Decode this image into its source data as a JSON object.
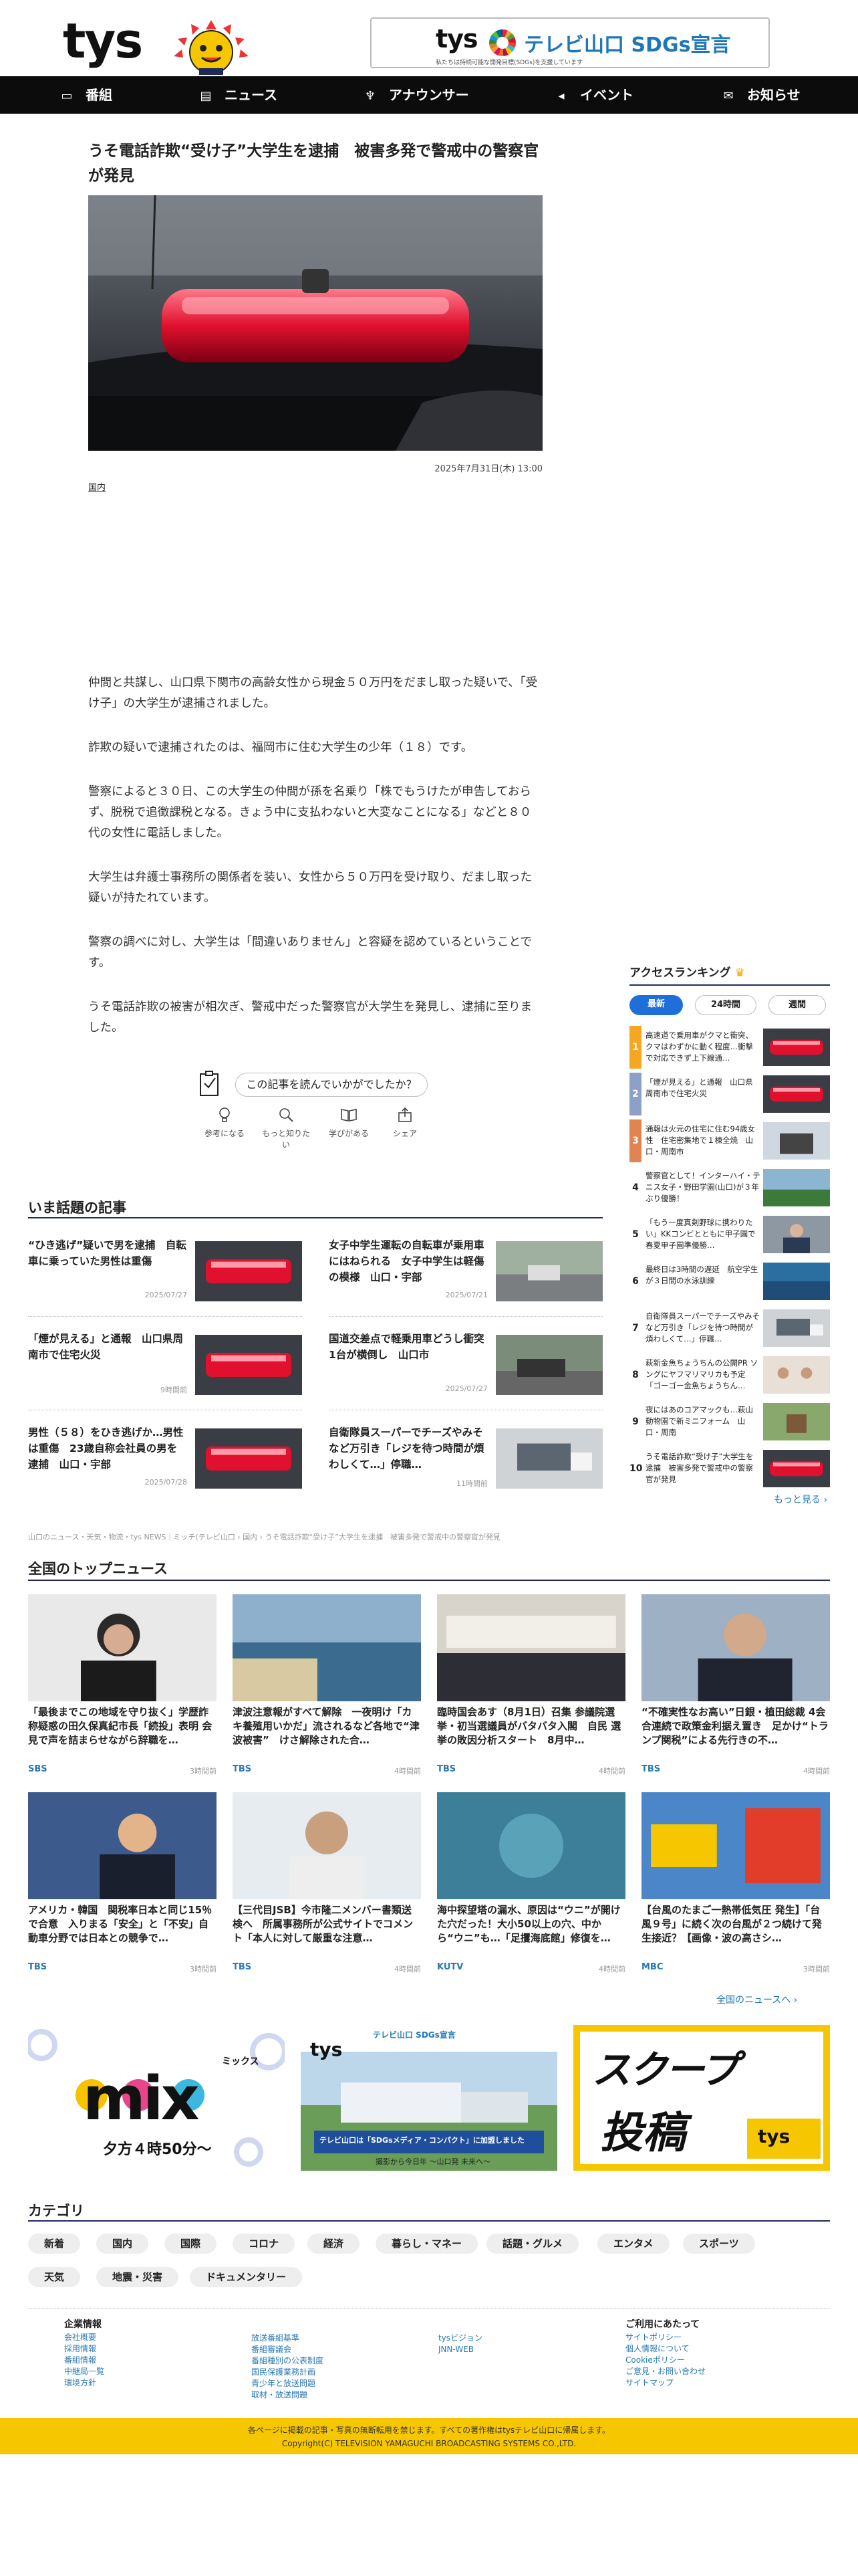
{
  "header": {
    "logo_text": "tys",
    "sdgs": {
      "brand": "tys",
      "title": "テレビ山口 SDGs宣言",
      "sub": "私たちは持続可能な開発目標(SDGs)を支援しています"
    }
  },
  "nav": [
    {
      "icon": "tv-icon",
      "label": "番組"
    },
    {
      "icon": "news-icon",
      "label": "ニュース"
    },
    {
      "icon": "microphone-icon",
      "label": "アナウンサー"
    },
    {
      "icon": "megaphone-icon",
      "label": "イベント"
    },
    {
      "icon": "mail-icon",
      "label": "お知らせ"
    }
  ],
  "article": {
    "title": "うそ電話詐欺“受け子”大学生を逮捕　被害多発で警戒中の警察官が発見",
    "date": "2025年7月31日(木) 13:00",
    "category": "国内",
    "paragraphs": [
      "仲間と共謀し、山口県下関市の高齢女性から現金５０万円をだまし取った疑いで、「受け子」の大学生が逮捕されました。",
      "詐欺の疑いで逮捕されたのは、福岡市に住む大学生の少年（１８）です。",
      "警察によると３０日、この大学生の仲間が孫を名乗り「株でもうけたが申告しておらず、脱税で追徴課税となる。きょう中に支払わないと大変なことになる」などと８０代の女性に電話しました。",
      "大学生は弁護士事務所の関係者を装い、女性から５０万円を受け取り、だまし取った疑いが持たれています。",
      "警察の調べに対し、大学生は「間違いありません」と容疑を認めているということです。",
      "うそ電話詐欺の被害が相次ぎ、警戒中だった警察官が大学生を発見し、逮捕に至りました。"
    ],
    "feedback_label": "この記事を読んでいかがでしたか？",
    "reactions": [
      {
        "icon": "lightbulb-icon",
        "label": "参考になる"
      },
      {
        "icon": "magnifier-icon",
        "label": "もっと知りたい"
      },
      {
        "icon": "book-icon",
        "label": "学びがある"
      },
      {
        "icon": "share-icon",
        "label": "シェア"
      }
    ]
  },
  "popular": {
    "heading": "いま話題の記事",
    "items": [
      {
        "title": "“ひき逃げ”疑いで男を逮捕　自転車に乗っていた男性は重傷",
        "date": "2025/07/27",
        "thumb": "siren"
      },
      {
        "title": "女子中学生運転の自転車が乗用車にはねられる　女子中学生は軽傷の模様　山口・宇部",
        "date": "2025/07/21",
        "thumb": "road"
      },
      {
        "title": "「煙が見える」と通報　山口県周南市で住宅火災",
        "date": "9時間前",
        "thumb": "siren"
      },
      {
        "title": "国道交差点で軽乗用車どうし衝突　1台が横倒し　山口市",
        "date": "2025/07/27",
        "thumb": "crash"
      },
      {
        "title": "男性（５８）をひき逃げか…男性は重傷　23歳自称会社員の男を逮捕　山口・宇部",
        "date": "2025/07/28",
        "thumb": "siren"
      },
      {
        "title": "自衛隊員スーパーでチーズやみそなど万引き「レジを待つ時間が煩わしくて…」停職…",
        "date": "11時間前",
        "thumb": "cam"
      }
    ]
  },
  "ranking": {
    "heading": "アクセスランキング",
    "tabs": [
      "最新",
      "24時間",
      "週間"
    ],
    "items": [
      {
        "num": "1",
        "text": "高速道で乗用車がクマと衝突、クマはわずかに動く程度…衝撃で対応できず上下線通…",
        "color": "#f5a623",
        "thumb": "siren"
      },
      {
        "title": "",
        "num": "2",
        "text": "「煙が見える」と通報　山口県周南市で住宅火災",
        "color": "#8da0c8",
        "thumb": "siren"
      },
      {
        "num": "3",
        "text": "通報は火元の住宅に住む94歳女性　住宅密集地で１棟全焼　山口・周南市",
        "color": "#e2844f",
        "thumb": "fire"
      },
      {
        "num": "4",
        "text": "警察官として！インターハイ・テニス女子・野田学園(山口)が３年ぶり優勝！",
        "color": "",
        "thumb": "team"
      },
      {
        "num": "5",
        "text": "「もう一度真剣野球に携わりたい」KKコンビとともに甲子園で春夏甲子園準優勝…",
        "color": "",
        "thumb": "man"
      },
      {
        "num": "6",
        "text": "最終日は3時間の遅延　航空学生が３日間の水泳訓練",
        "color": "",
        "thumb": "water"
      },
      {
        "num": "7",
        "text": "自衛隊員スーパーでチーズやみそなど万引き「レジを待つ時間が煩わしくて…」停職…",
        "color": "",
        "thumb": "cam"
      },
      {
        "num": "8",
        "text": "萩新金魚ちょうちんの公開PR ソングにヤフマリマリカも予定「ゴーゴー金魚ちょうちん…",
        "color": "",
        "thumb": "people"
      },
      {
        "num": "9",
        "text": "夜にはあのコアマックも…萩山動物園で新ミニフォーム　山口・周南",
        "color": "",
        "thumb": "zoo"
      },
      {
        "num": "10",
        "text": "うそ電話詐欺“受け子”大学生を逮捕　被害多発で警戒中の警察官が発見",
        "color": "",
        "thumb": "siren"
      }
    ],
    "more": "もっと見る ›"
  },
  "breadcrumb": "山口のニュース・天気・物流・tys NEWS｜ミッチ(テレビ山口 › 国内 › うそ電話詐欺“受け子”大学生を逮捕　被害多発で警戒中の警察官が発見",
  "national": {
    "heading": "全国のトップニュース",
    "items": [
      {
        "title": "「最後までこの地域を守り抜く」学歴詐称疑惑の田久保真紀市長「続投」表明 会見で声を詰まらせながら辞職を…",
        "src": "SBS",
        "time": "3時間前",
        "thumb": "woman"
      },
      {
        "title": "津波注意報がすべて解除　一夜明け「カキ養殖用いかだ」流されるなど各地で“津波被害”　けさ解除された合…",
        "src": "TBS",
        "time": "4時間前",
        "thumb": "beach"
      },
      {
        "title": "臨時国会あす（8月1日）召集 参議院選挙・初当選議員がバタバタ入閣　自民 選挙の敗因分析スタート　8月中…",
        "src": "TBS",
        "time": "4時間前",
        "thumb": "meeting"
      },
      {
        "title": "“不確実性なお高い”日銀・植田総裁 4会合連続で政策金利据え置き　足かけ“トランプ関税”による先行きの不…",
        "src": "TBS",
        "time": "4時間前",
        "thumb": "old-man"
      },
      {
        "title": "アメリカ・韓国　関税率日本と同じ15％で合意　入りまる「安全」と「不安」自動車分野では日本との競争で…",
        "src": "TBS",
        "time": "3時間前",
        "thumb": "trump"
      },
      {
        "title": "【三代目JSB】今市隆二メンバー書類送検へ　所属事務所が公式サイトでコメント「本人に対して厳重な注意…",
        "src": "TBS",
        "time": "4時間前",
        "thumb": "young-man"
      },
      {
        "title": "海中探望塔の漏水、原因は“ウニ”が開けた穴だった！大小50以上の穴、中から“ウニ”も…「足攫海底館」修復を…",
        "src": "KUTV",
        "time": "4時間前",
        "thumb": "underwater"
      },
      {
        "title": "【台風のたまご一熱帯低気圧 発生】「台風９号」に続く次の台風が２つ続けて発生接近？【画像・波の高さシ…",
        "src": "MBC",
        "time": "3時間前",
        "thumb": "typhoon"
      }
    ],
    "more": "全国のニュースへ ›"
  },
  "banners": [
    {
      "name": "mix",
      "big": "mix",
      "sub": "ミックス",
      "time": "夕方４時50分～"
    },
    {
      "name": "sdgs",
      "top": "テレビ山口 SDGs宣言",
      "cap": "テレビ山口は「SDGsメディア・コンパクト」に加盟しました",
      "foot": "撮影から今日年 ～山口発 未来へ～"
    },
    {
      "name": "scoop",
      "big": "スクープ",
      "big2": "投稿"
    }
  ],
  "categories": {
    "heading": "カテゴリ",
    "items": [
      "新着",
      "国内",
      "国際",
      "コロナ",
      "経済",
      "暮らし・マネー",
      "話題・グルメ",
      "エンタメ",
      "スポーツ",
      "天気",
      "地震・災害",
      "ドキュメンタリー"
    ]
  },
  "footer": {
    "col1": {
      "heading": "企業情報",
      "links": [
        "会社概要",
        "採用情報",
        "番組情報",
        "中継局一覧",
        "環境方針"
      ]
    },
    "col2": {
      "heading": "",
      "links": [
        "放送番組基準",
        "番組審議会",
        "番組種別の公表制度",
        "国民保護業務計画",
        "青少年と放送問題",
        "取材・放送問題"
      ]
    },
    "col3": {
      "heading": "",
      "links": [
        "tysビジョン",
        "JNN-WEB"
      ]
    },
    "col4": {
      "heading": "ご利用にあたって",
      "links": [
        "サイトポリシー",
        "個人情報について",
        "Cookieポリシー",
        "ご意見・お問い合わせ",
        "サイトマップ"
      ]
    },
    "copy1": "各ページに掲載の記事・写真の無断転用を禁じます。すべての著作権はtysテレビ山口に帰属します。",
    "copy2": "Copyright(C) TELEVISION YAMAGUCHI BROADCASTING SYSTEMS CO.,LTD."
  },
  "colors": {
    "nav_bg": "#0c0c0c",
    "accent_blue": "#1d77b8",
    "footer_yellow": "#f6c700",
    "ranking_tab_active": "#1e6fd9"
  }
}
